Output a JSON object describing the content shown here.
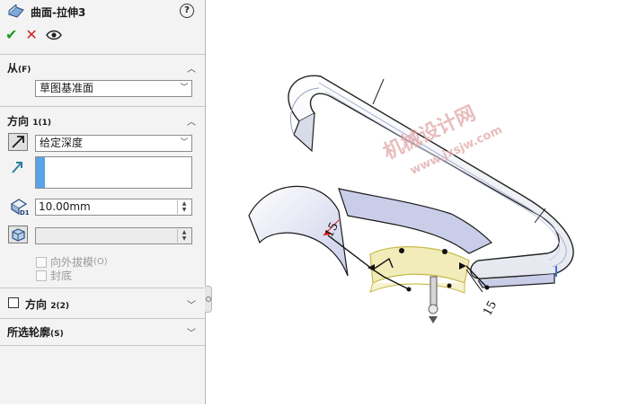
{
  "panel": {
    "title": "曲面-拉伸3",
    "help_label": "?",
    "from_section": {
      "label": "从",
      "suffix": "(F)",
      "start_value": "草图基准面"
    },
    "direction1": {
      "label": "方向",
      "suffix": "1(1)",
      "end_condition": "给定深度",
      "depth": "10.00mm",
      "draft_label": "向外拔模",
      "draft_suffix": "(O)",
      "cap_label": "封底"
    },
    "direction2": {
      "label": "方向",
      "suffix": "2(2)"
    },
    "contours": {
      "label": "所选轮廓",
      "suffix": "(S)"
    }
  },
  "viewport": {
    "dim_label_top": "15",
    "dim_label_bottom": "15",
    "watermark_line1": "机械设计网",
    "watermark_line2": "www.jxsjw.com"
  },
  "colors": {
    "accept": "#1e9a1e",
    "cancel": "#d42020",
    "selection_blue": "#5aa2e6",
    "surface_yellow": "#f1ecba",
    "surface_blue": "#c9cde8"
  }
}
